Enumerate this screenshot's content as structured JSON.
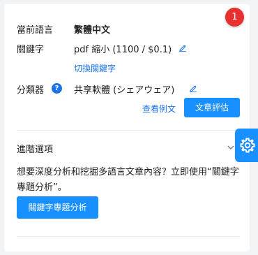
{
  "badge": {
    "count": "1"
  },
  "language": {
    "label": "當前語言",
    "value": "繁體中文"
  },
  "keyword": {
    "label": "關鍵字",
    "value": "pdf 縮小 (1100 / $0.1)",
    "switch_link": "切換關鍵字"
  },
  "category": {
    "label": "分類器",
    "help": "?",
    "value": "共享軟體 (シェアウェア)"
  },
  "actions": {
    "view_example": "查看例文",
    "evaluate": "文章評估"
  },
  "advanced": {
    "title": "進階選項"
  },
  "promo": {
    "text": "想要深度分析和挖掘多語言文章內容？立即使用“關鍵字專題分析”。",
    "button": "關鍵字專題分析"
  },
  "colors": {
    "accent": "#1890ff",
    "link": "#1a73e8",
    "badge": "#e8312f"
  },
  "icons": {
    "edit": "pencil-icon",
    "settings": "gear-icon",
    "expand": "chevron-down-icon"
  }
}
